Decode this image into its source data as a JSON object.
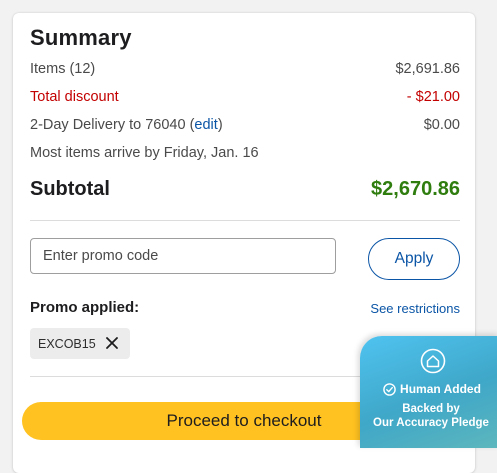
{
  "summary": {
    "title": "Summary",
    "items_label": "Items (12)",
    "items_value": "$2,691.86",
    "discount_label": "Total discount",
    "discount_value": "- $21.00",
    "delivery_label_prefix": "2-Day Delivery to 76040 (",
    "delivery_edit_link": "edit",
    "delivery_label_suffix": ")",
    "delivery_value": "$0.00",
    "arrival_note": "Most items arrive by Friday, Jan. 16",
    "subtotal_label": "Subtotal",
    "subtotal_value": "$2,670.86"
  },
  "promo": {
    "input_placeholder": "Enter promo code",
    "input_value": "",
    "apply_label": "Apply",
    "applied_label": "Promo applied:",
    "restrictions_link": "See restrictions",
    "applied_code": "EXCOB15"
  },
  "checkout": {
    "button_label": "Proceed to checkout"
  },
  "badge": {
    "headline": "Human Added",
    "line1": "Backed by",
    "line2": "Our Accuracy Pledge",
    "icon": "home-icon"
  },
  "colors": {
    "discount": "#c30000",
    "subtotal": "#2f7d0e",
    "link": "#0b55a6",
    "checkout_button": "#ffc220",
    "badge_gradient_start": "#4fc3f0",
    "badge_gradient_end": "#5db7bd"
  }
}
